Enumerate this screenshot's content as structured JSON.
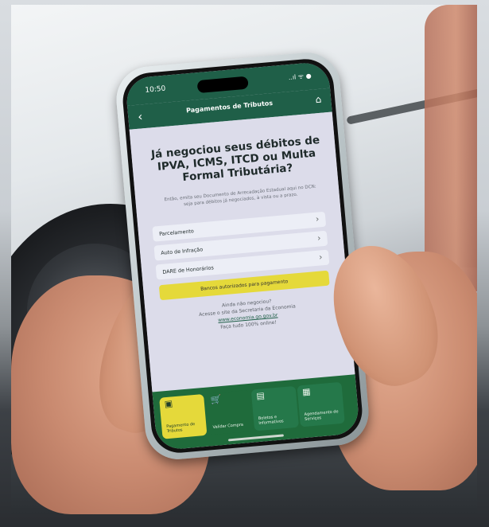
{
  "phone": {
    "time": "10:50",
    "status_icons": "..ıl ᯤ ●",
    "app_title": "Pagamentos de Tributos",
    "back_glyph": "‹",
    "home_glyph": "⌂"
  },
  "content": {
    "headline": "Já negociou seus débitos de IPVA, ICMS, ITCD ou Multa Formal Tributária?",
    "subtext": "Então, emita seu Documento de Arrecadação Estadual aqui no DCN: seja para débitos já negociados, à vista ou a prazo.",
    "options": [
      {
        "label": "Parcelamento",
        "chevron": "›"
      },
      {
        "label": "Auto de Infração",
        "chevron": "›"
      },
      {
        "label": "DARE de Honorários",
        "chevron": "›"
      }
    ],
    "cta_label": "Bancos autorizados para pagamento",
    "info_line1": "Ainda não negociou?",
    "info_line2": "Acesse o site da Secretaria da Economia",
    "info_link": "www.economia.go.gov.br",
    "info_line3": "Faça tudo 100% online!"
  },
  "bottom_nav": [
    {
      "icon": "▣",
      "label": "Pagamento de Tributos"
    },
    {
      "icon": "🛒",
      "label": "Validar Compra"
    },
    {
      "icon": "▤",
      "label": "Boletos e Informativos"
    },
    {
      "icon": "▦",
      "label": "Agendamento de Serviços"
    }
  ]
}
